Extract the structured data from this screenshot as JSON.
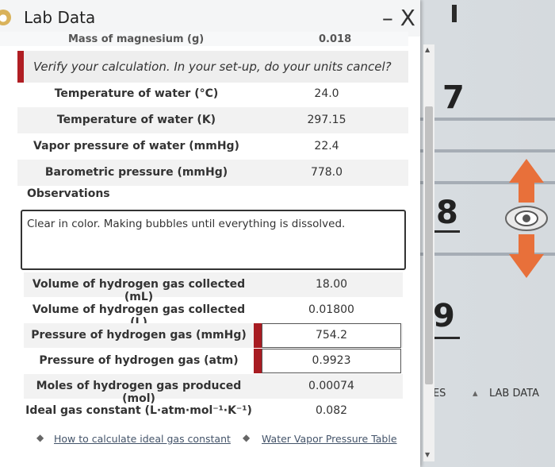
{
  "window": {
    "title": "Lab Data",
    "close_label": "– X"
  },
  "cut_row": {
    "label": "Mass of magnesium (g)",
    "value": "0.018"
  },
  "verify_text": "Verify your calculation. In your set-up, do your units cancel?",
  "table1": [
    {
      "label": "Temperature of water (°C)",
      "value": "24.0"
    },
    {
      "label": "Temperature of water (K)",
      "value": "297.15"
    },
    {
      "label": "Vapor pressure of water (mmHg)",
      "value": "22.4"
    },
    {
      "label": "Barometric pressure (mmHg)",
      "value": "778.0"
    }
  ],
  "observations": {
    "label": "Observations",
    "text": "Clear in color. Making bubbles until everything is dissolved."
  },
  "table2": [
    {
      "label": "Volume of hydrogen gas collected (mL)",
      "value": "18.00"
    },
    {
      "label": "Volume of hydrogen gas collected (L)",
      "value": "0.01800"
    },
    {
      "label": "Pressure of hydrogen gas (mmHg)",
      "value": "754.2"
    },
    {
      "label": "Pressure of hydrogen gas (atm)",
      "value": "0.9923"
    },
    {
      "label": "Moles of hydrogen gas produced (mol)",
      "value": "0.00074"
    },
    {
      "label": "Ideal gas constant (L·atm·mol⁻¹·K⁻¹)",
      "value": "0.082"
    }
  ],
  "links": {
    "ideal_gas": "How to calculate ideal gas constant",
    "vapor_table": "Water Vapor Pressure Table"
  },
  "background": {
    "num7": "7",
    "num8": "8",
    "num9": "9",
    "notes_tab": "TES",
    "lab_data_tab": "LAB DATA"
  },
  "colors": {
    "accent_red": "#b01e23",
    "arrow_orange": "#e8703a"
  },
  "icons": [
    "close-icon",
    "link-bullet-icon",
    "eye-icon",
    "flask-icon"
  ]
}
